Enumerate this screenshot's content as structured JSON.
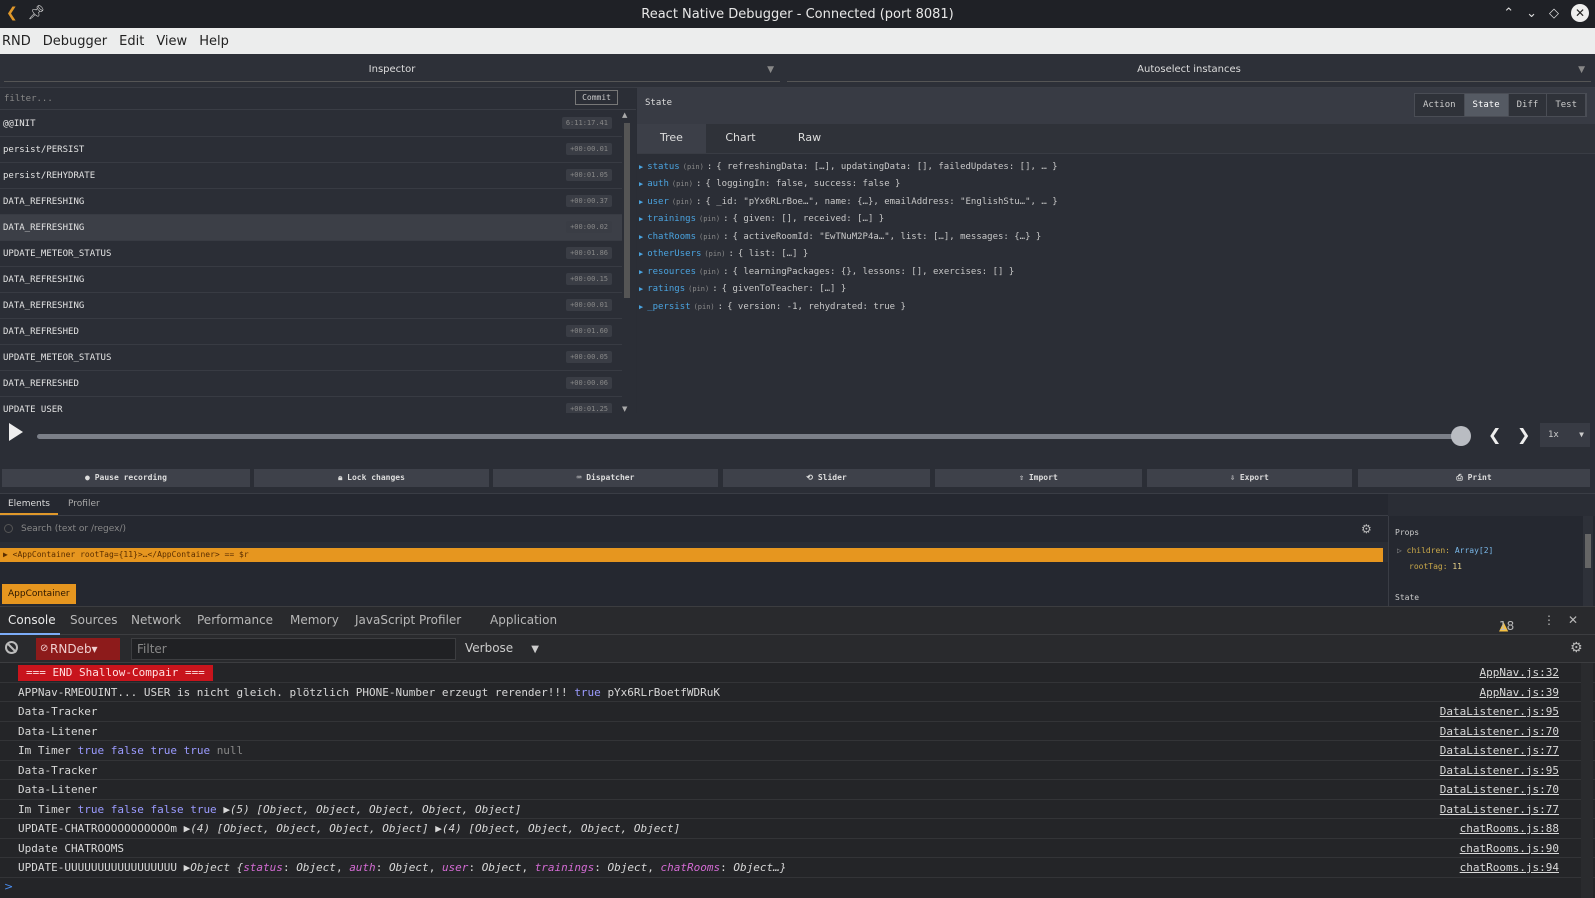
{
  "window": {
    "title": "React Native Debugger - Connected (port 8081)"
  },
  "menu": [
    "RND",
    "Debugger",
    "Edit",
    "View",
    "Help"
  ],
  "instance_selectors": {
    "left": "Inspector",
    "right": "Autoselect instances"
  },
  "inspector": {
    "filter_placeholder": "filter...",
    "commit_label": "Commit",
    "actions": [
      {
        "name": "@@INIT",
        "time": "6:11:17.41"
      },
      {
        "name": "persist/PERSIST",
        "time": "+00:00.01"
      },
      {
        "name": "persist/REHYDRATE",
        "time": "+00:01.05"
      },
      {
        "name": "DATA_REFRESHING",
        "time": "+00:00.37"
      },
      {
        "name": "DATA_REFRESHING",
        "time": "+00:00.02"
      },
      {
        "name": "UPDATE_METEOR_STATUS",
        "time": "+00:01.86"
      },
      {
        "name": "DATA_REFRESHING",
        "time": "+00:00.15"
      },
      {
        "name": "DATA_REFRESHING",
        "time": "+00:00.01"
      },
      {
        "name": "DATA_REFRESHED",
        "time": "+00:01.60"
      },
      {
        "name": "UPDATE_METEOR_STATUS",
        "time": "+00:00.05"
      },
      {
        "name": "DATA_REFRESHED",
        "time": "+00:00.06"
      },
      {
        "name": "UPDATE_USER",
        "time": "+00:01.25"
      }
    ],
    "selected_index": 4
  },
  "state_panel": {
    "title": "State",
    "monitor_buttons": [
      "Action",
      "State",
      "Diff",
      "Test"
    ],
    "active_monitor": "State",
    "tabs": [
      "Tree",
      "Chart",
      "Raw"
    ],
    "active_tab": "Tree",
    "pin_label": "(pin)",
    "tree": [
      {
        "key": "status",
        "value": "{ refreshingData: […], updatingData: [], failedUpdates: [], … }"
      },
      {
        "key": "auth",
        "value": "{ loggingIn: false, success: false }"
      },
      {
        "key": "user",
        "value": "{ _id: \"pYx6RLrBoe…\", name: {…}, emailAddress: \"EnglishStu…\", … }"
      },
      {
        "key": "trainings",
        "value": "{ given: [], received: […] }"
      },
      {
        "key": "chatRooms",
        "value": "{ activeRoomId: \"EwTNuM2P4a…\", list: […], messages: {…} }"
      },
      {
        "key": "otherUsers",
        "value": "{ list: […] }"
      },
      {
        "key": "resources",
        "value": "{ learningPackages: {}, lessons: [], exercises: [] }"
      },
      {
        "key": "ratings",
        "value": "{ givenToTeacher: […] }"
      },
      {
        "key": "_persist",
        "value": "{ version: -1, rehydrated: true }"
      }
    ]
  },
  "playback": {
    "speed": "1x",
    "position": 1.0
  },
  "toolbar_buttons": [
    {
      "label": "Pause recording",
      "icon": "record-icon"
    },
    {
      "label": "Lock changes",
      "icon": "lock-icon"
    },
    {
      "label": "Dispatcher",
      "icon": "keyboard-icon"
    },
    {
      "label": "Slider",
      "icon": "history-icon"
    },
    {
      "label": "Import",
      "icon": "upload-icon"
    },
    {
      "label": "Export",
      "icon": "download-icon"
    },
    {
      "label": "Print",
      "icon": "print-icon"
    }
  ],
  "react_devtools": {
    "tabs": [
      "Elements",
      "Profiler"
    ],
    "active_tab": "Elements",
    "search_placeholder": "Search (text or /regex/)",
    "dom_row": "▶ <AppContainer rootTag={11}>…</AppContainer> == $r",
    "breadcrumb": "AppContainer",
    "props": {
      "header": "Props",
      "children_key": "children:",
      "children_value": "Array[2]",
      "roottag_key": "rootTag:",
      "roottag_value": "11",
      "state_header": "State"
    }
  },
  "chrome_devtools": {
    "tabs": [
      "Console",
      "Sources",
      "Network",
      "Performance",
      "Memory",
      "JavaScript Profiler",
      "Application"
    ],
    "active_tab": "Console",
    "warning_count": "18",
    "context": "RNDeb▾",
    "filter_placeholder": "Filter",
    "level": "Verbose"
  },
  "console": {
    "lines": [
      {
        "text": "=== END Shallow-Compair ===",
        "src": "AppNav.js:32"
      },
      {
        "text": "APPNav-RMEOUINT... USER is nicht gleich. plötzlich PHONE-Number erzeugt rerender!!!",
        "kw": "true",
        "tail": "pYx6RLrBoetfWDRuK",
        "src": "AppNav.js:39"
      },
      {
        "text": "Data-Tracker",
        "src": "DataListener.js:95"
      },
      {
        "text": "Data-Litener",
        "src": "DataListener.js:70"
      },
      {
        "text": "Im Timer",
        "kw": "true false true true",
        "null": "null",
        "src": "DataListener.js:77"
      },
      {
        "text": "Data-Tracker",
        "src": "DataListener.js:95"
      },
      {
        "text": "Data-Litener",
        "src": "DataListener.js:70"
      },
      {
        "text": "Im Timer",
        "kw": "true false false true",
        "obj": "▶(5) [Object, Object, Object, Object, Object]",
        "src": "DataListener.js:77"
      },
      {
        "text": "UPDATE-CHATROOOOOOOOOOOm",
        "obj": "▶(4) [Object, Object, Object, Object] ▶(4) [Object, Object, Object, Object]",
        "src": "chatRooms.js:88"
      },
      {
        "text": "Update CHATROOMS",
        "src": "chatRooms.js:90"
      },
      {
        "text": "UPDATE-UUUUUUUUUUUUUUUUU",
        "obj_prefix": "▶Object {",
        "src": "chatRooms.js:94"
      }
    ],
    "last_object": [
      {
        "k": "status",
        "v": "Object"
      },
      {
        "k": "auth",
        "v": "Object"
      },
      {
        "k": "user",
        "v": "Object"
      },
      {
        "k": "trainings",
        "v": "Object"
      },
      {
        "k": "chatRooms",
        "v": "Object…}"
      }
    ],
    "prompt": ">"
  }
}
